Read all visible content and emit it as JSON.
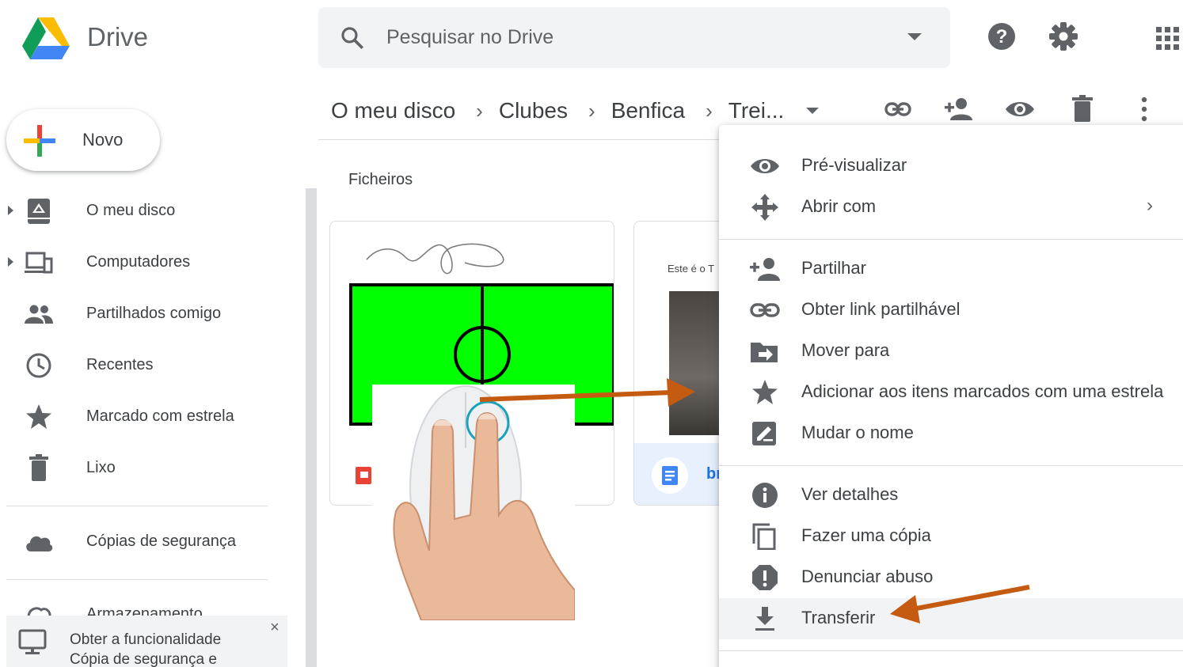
{
  "app": {
    "title": "Drive"
  },
  "search": {
    "placeholder": "Pesquisar no Drive"
  },
  "header_icons": [
    "help-icon",
    "settings-icon",
    "apps-grid-icon"
  ],
  "breadcrumb": {
    "items": [
      "O meu disco",
      "Clubes",
      "Benfica",
      "Trei..."
    ]
  },
  "toolbar_icons": [
    "get-link-icon",
    "share-icon",
    "preview-icon",
    "delete-icon",
    "more-options-icon"
  ],
  "sidebar": {
    "new_label": "Novo",
    "items": [
      {
        "label": "O meu disco",
        "icon": "my-drive-icon"
      },
      {
        "label": "Computadores",
        "icon": "computers-icon"
      },
      {
        "label": "Partilhados comigo",
        "icon": "shared-icon"
      },
      {
        "label": "Recentes",
        "icon": "clock-icon"
      },
      {
        "label": "Marcado com estrela",
        "icon": "star-icon"
      },
      {
        "label": "Lixo",
        "icon": "trash-icon"
      },
      {
        "label": "Cópias de segurança",
        "icon": "cloud-icon"
      }
    ],
    "storage_label": "Armazenamento",
    "promo": {
      "line1": "Obter a funcionalidade",
      "line2": "Cópia de segurança e",
      "close": "×"
    }
  },
  "main": {
    "section_title": "Ficheiros",
    "file2": {
      "preview_text": "Este é o T",
      "name_fragment": "br"
    }
  },
  "context_menu": {
    "items": [
      {
        "label": "Pré-visualizar",
        "icon": "preview-icon"
      },
      {
        "label": "Abrir com",
        "icon": "open-with-icon",
        "submenu": "›"
      },
      {
        "label": "Partilhar",
        "icon": "share-icon"
      },
      {
        "label": "Obter link partilhável",
        "icon": "link-icon"
      },
      {
        "label": "Mover para",
        "icon": "move-icon"
      },
      {
        "label": "Adicionar aos itens marcados com uma estrela",
        "icon": "star-icon"
      },
      {
        "label": "Mudar o nome",
        "icon": "rename-icon"
      },
      {
        "label": "Ver detalhes",
        "icon": "info-icon"
      },
      {
        "label": "Fazer uma cópia",
        "icon": "copy-icon"
      },
      {
        "label": "Denunciar abuso",
        "icon": "report-icon"
      },
      {
        "label": "Transferir",
        "icon": "download-icon"
      }
    ],
    "highlighted": "Transferir"
  },
  "colors": {
    "accent": "#1a73e8",
    "annotation_arrow": "#c55a11",
    "field_green": "#00ff00"
  }
}
